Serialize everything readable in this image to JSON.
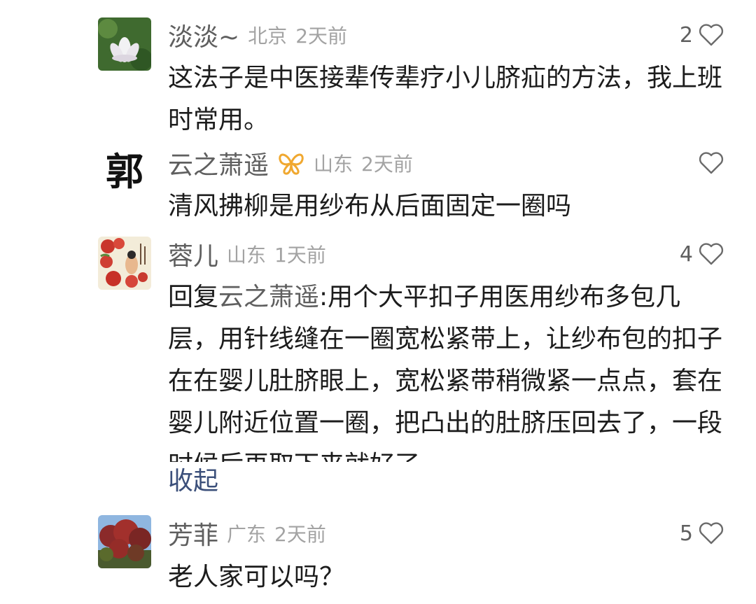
{
  "comments": [
    {
      "user": "淡淡~",
      "location": "北京",
      "time": "2天前",
      "likes": "2",
      "avatar": "lotus-flower-avatar",
      "body": "这法子是中医接辈传辈疗小儿脐疝的方法，我上班时常用。"
    },
    {
      "user": "云之萧遥",
      "badge": "butterfly-badge-icon",
      "badge_color": "#f0a830",
      "location": "山东",
      "time": "2天前",
      "likes": "",
      "avatar": "calligraphy-guo-avatar",
      "avatar_char": "郭",
      "body": "清风拂柳是用纱布从后面固定一圈吗"
    },
    {
      "user": "蓉儿",
      "location": "山东",
      "time": "1天前",
      "likes": "4",
      "avatar": "apples-painting-avatar",
      "reply_prefix": "回复",
      "reply_to": "云之萧遥",
      "reply_colon": ":",
      "body": "用个大平扣子用医用纱布多包几层，用针线缝在一圈宽松紧带上，让纱布包的扣子在在婴儿肚脐眼上，宽松紧带稍微紧一点点，套在婴儿附近位置一圈，把凸出的肚脐压回去了，一段时候后再取下来就好了",
      "collapse_label": "收起"
    },
    {
      "user": "芳菲",
      "location": "广东",
      "time": "2天前",
      "likes": "5",
      "avatar": "red-tree-sky-avatar",
      "body": "老人家可以吗？"
    }
  ],
  "colors": {
    "name": "#5f5f5f",
    "meta": "#a3a3a3",
    "body": "#1c1c1c",
    "link": "#3b4f7a",
    "heart_outline": "#6b6b6b"
  }
}
